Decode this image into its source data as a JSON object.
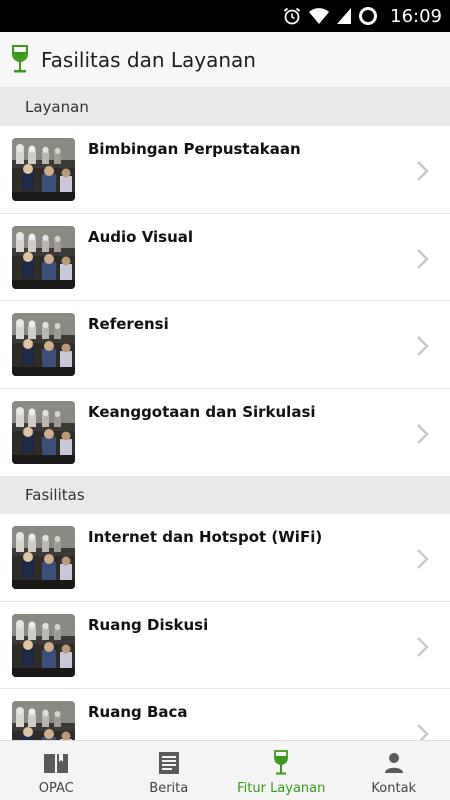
{
  "status_bar": {
    "time": "16:09"
  },
  "header": {
    "title": "Fasilitas dan Layanan"
  },
  "sections": [
    {
      "title": "Layanan",
      "items": [
        {
          "label": "Bimbingan Perpustakaan"
        },
        {
          "label": "Audio Visual"
        },
        {
          "label": "Referensi"
        },
        {
          "label": "Keanggotaan dan Sirkulasi"
        }
      ]
    },
    {
      "title": "Fasilitas",
      "items": [
        {
          "label": "Internet dan Hotspot (WiFi)"
        },
        {
          "label": "Ruang Diskusi"
        },
        {
          "label": "Ruang Baca"
        }
      ]
    }
  ],
  "bottom_nav": [
    {
      "label": "OPAC",
      "icon": "book-icon",
      "active": false
    },
    {
      "label": "Berita",
      "icon": "news-icon",
      "active": false
    },
    {
      "label": "Fitur Layanan",
      "icon": "glass-icon",
      "active": true
    },
    {
      "label": "Kontak",
      "icon": "person-icon",
      "active": false
    }
  ],
  "colors": {
    "accent": "#3a9a1a",
    "header_bg": "#f7f7f7",
    "section_bg": "#e9e9e9",
    "status_bar": "#000000"
  }
}
